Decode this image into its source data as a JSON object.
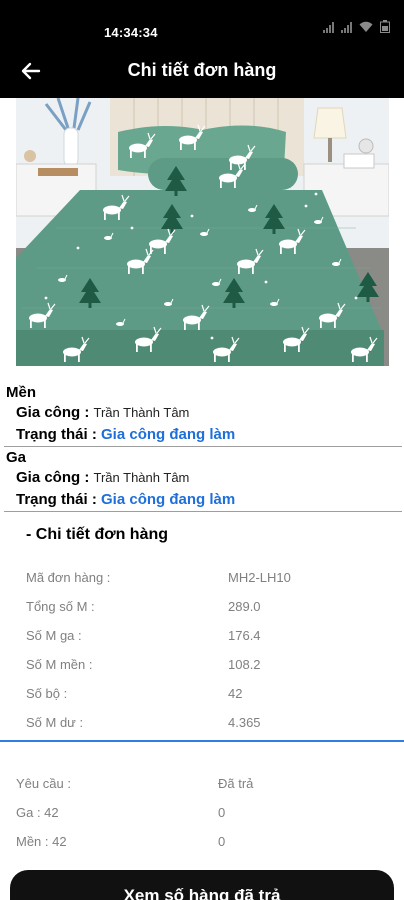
{
  "status_bar": {
    "time": "14:34:34"
  },
  "header": {
    "title": "Chi tiết đơn hàng"
  },
  "product_image": {
    "description": "mint-green-deer-bedding",
    "colors": {
      "fabric": "#5e9b86",
      "tree": "#1f5a45",
      "deer": "#ffffff"
    }
  },
  "sections": [
    {
      "title": "Mền",
      "worker_label": "Gia công :",
      "worker_name": "Trần Thành Tâm",
      "status_label": "Trạng thái :",
      "status_value": "Gia công đang làm"
    },
    {
      "title": "Ga",
      "worker_label": "Gia công :",
      "worker_name": "Trần Thành Tâm",
      "status_label": "Trạng thái :",
      "status_value": "Gia công đang làm"
    }
  ],
  "order_detail": {
    "heading": "- Chi tiết đơn hàng",
    "rows": [
      {
        "label": "Mã đơn hàng :",
        "value": "MH2-LH10"
      },
      {
        "label": "Tổng số M :",
        "value": "289.0"
      },
      {
        "label": "Số M ga :",
        "value": "176.4"
      },
      {
        "label": "Số M mền :",
        "value": "108.2"
      },
      {
        "label": "Số bộ :",
        "value": "42"
      },
      {
        "label": "Số M dư :",
        "value": "4.365"
      }
    ]
  },
  "requirements": {
    "header_left": "Yêu cầu :",
    "header_right": "Đã trả",
    "rows": [
      {
        "label": "Ga : 42",
        "value": "0"
      },
      {
        "label": "Mền : 42",
        "value": "0"
      }
    ]
  },
  "actions": {
    "view_returned_label": "Xem số hàng đã trả"
  },
  "colors": {
    "status_blue": "#1e6fd9",
    "bar_black": "#000000",
    "divider_blue": "#2d7fe0"
  }
}
